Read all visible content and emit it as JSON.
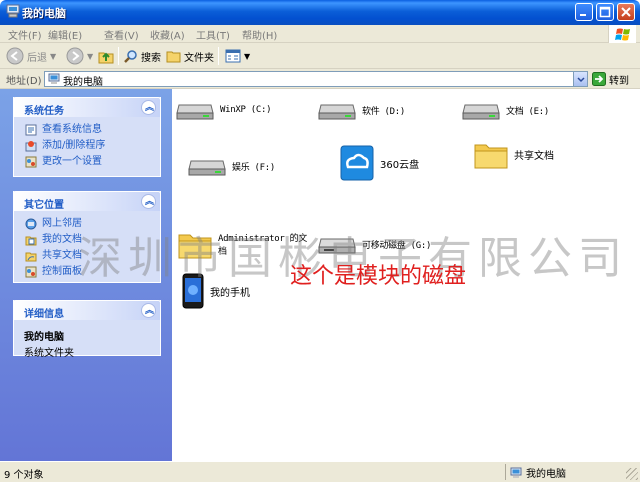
{
  "window": {
    "title": "我的电脑"
  },
  "menu": [
    "文件(F)",
    "编辑(E)",
    "查看(V)",
    "收藏(A)",
    "工具(T)",
    "帮助(H)"
  ],
  "toolbar": {
    "back_label": "后退",
    "search_label": "搜索",
    "folders_label": "文件夹"
  },
  "address": {
    "label": "地址(D)",
    "value": "我的电脑",
    "go_label": "转到"
  },
  "left_pane": {
    "system_tasks": {
      "title": "系统任务",
      "items": [
        "查看系统信息",
        "添加/删除程序",
        "更改一个设置"
      ]
    },
    "other_places": {
      "title": "其它位置",
      "items": [
        "网上邻居",
        "我的文档",
        "共享文档",
        "控制面板"
      ]
    },
    "details": {
      "title": "详细信息",
      "name": "我的电脑",
      "type": "系统文件夹"
    }
  },
  "items": [
    {
      "name": "WinXP (C:)",
      "icon": "hard-drive-icon"
    },
    {
      "name": "软件 (D:)",
      "icon": "hard-drive-icon"
    },
    {
      "name": "文档 (E:)",
      "icon": "hard-drive-icon"
    },
    {
      "name": "娱乐 (F:)",
      "icon": "hard-drive-icon"
    },
    {
      "name": "360云盘",
      "icon": "cloud-drive-icon"
    },
    {
      "name": "共享文档",
      "icon": "folder-icon"
    },
    {
      "name": "Administrator 的文档",
      "icon": "folder-icon"
    },
    {
      "name": "可移动磁盘 (G:)",
      "icon": "removable-drive-icon"
    },
    {
      "name": "我的手机",
      "icon": "phone-icon"
    }
  ],
  "watermark": "深圳市国彬电子有限公司",
  "annotation": "这个是模块的磁盘",
  "status": {
    "left": "9 个对象",
    "right": "我的电脑"
  },
  "colors": {
    "title_bar": "#0a5fe0",
    "task_pane": "#6f8de0",
    "link": "#215dc6",
    "annotation": "#e0201f"
  }
}
